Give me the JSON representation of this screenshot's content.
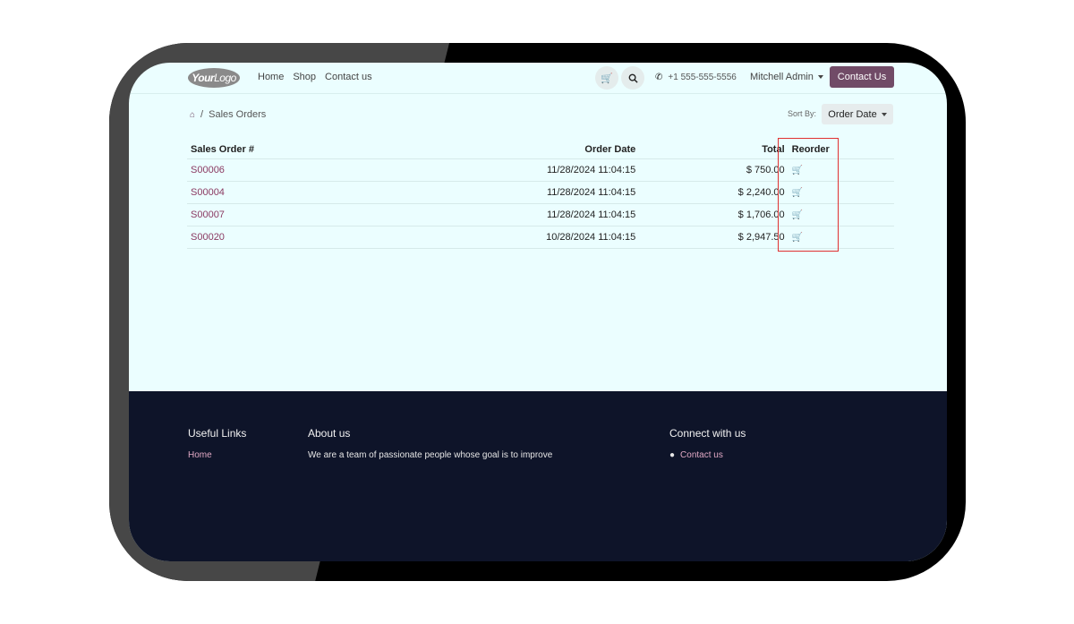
{
  "header": {
    "logo_text_bold": "Your",
    "logo_text_light": "Logo",
    "nav": [
      "Home",
      "Shop",
      "Contact us"
    ],
    "cart_icon": "cart-icon",
    "search_icon": "search-icon",
    "phone": "+1 555-555-5556",
    "user": "Mitchell Admin",
    "cta": "Contact Us"
  },
  "breadcrumb": {
    "home_icon": "home-icon",
    "separator": "/",
    "current": "Sales Orders"
  },
  "sort": {
    "label": "Sort By:",
    "value": "Order Date"
  },
  "table": {
    "columns": [
      "Sales Order #",
      "Order Date",
      "Total",
      "Reorder"
    ],
    "rows": [
      {
        "order": "S00006",
        "date": "11/28/2024  11:04:15",
        "total": "$ 750.00"
      },
      {
        "order": "S00004",
        "date": "11/28/2024  11:04:15",
        "total": "$ 2,240.00"
      },
      {
        "order": "S00007",
        "date": "11/28/2024  11:04:15",
        "total": "$ 1,706.00"
      },
      {
        "order": "S00020",
        "date": "10/28/2024  11:04:15",
        "total": "$ 2,947.50"
      }
    ]
  },
  "footer": {
    "useful_links_title": "Useful Links",
    "useful_links": [
      "Home"
    ],
    "about_title": "About us",
    "about_text": "We are a team of passionate people whose goal is to improve",
    "connect_title": "Connect with us",
    "connect_link": "Contact us"
  },
  "colors": {
    "brand": "#714b67",
    "link": "#8b3a62",
    "page_bg": "#ebfeff",
    "footer_bg": "#0e1429",
    "highlight": "#e03131"
  }
}
